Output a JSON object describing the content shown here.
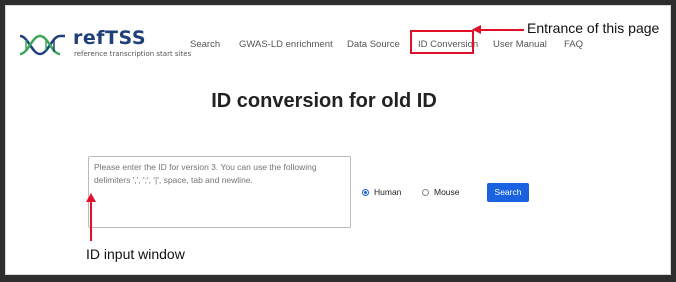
{
  "logo": {
    "title": "refTSS",
    "subtitle": "reference transcription start sites"
  },
  "nav": {
    "items": [
      {
        "label": "Search"
      },
      {
        "label": "GWAS-LD enrichment"
      },
      {
        "label": "Data Source"
      },
      {
        "label": "ID Conversion"
      },
      {
        "label": "User Manual"
      },
      {
        "label": "FAQ"
      }
    ]
  },
  "annotations": {
    "entrance": "Entrance of this page",
    "input_window": "ID input window"
  },
  "page": {
    "title": "ID conversion for old ID"
  },
  "form": {
    "textarea_placeholder": "Please enter the ID for version 3. You can use the following delimiters ',', ';', '|', space, tab and newline.",
    "species": [
      {
        "label": "Human",
        "checked": true
      },
      {
        "label": "Mouse",
        "checked": false
      }
    ],
    "search_label": "Search"
  },
  "colors": {
    "accent_blue": "#1a62e0",
    "annotation_red": "#e0102a",
    "logo_navy": "#1f3f7a"
  }
}
